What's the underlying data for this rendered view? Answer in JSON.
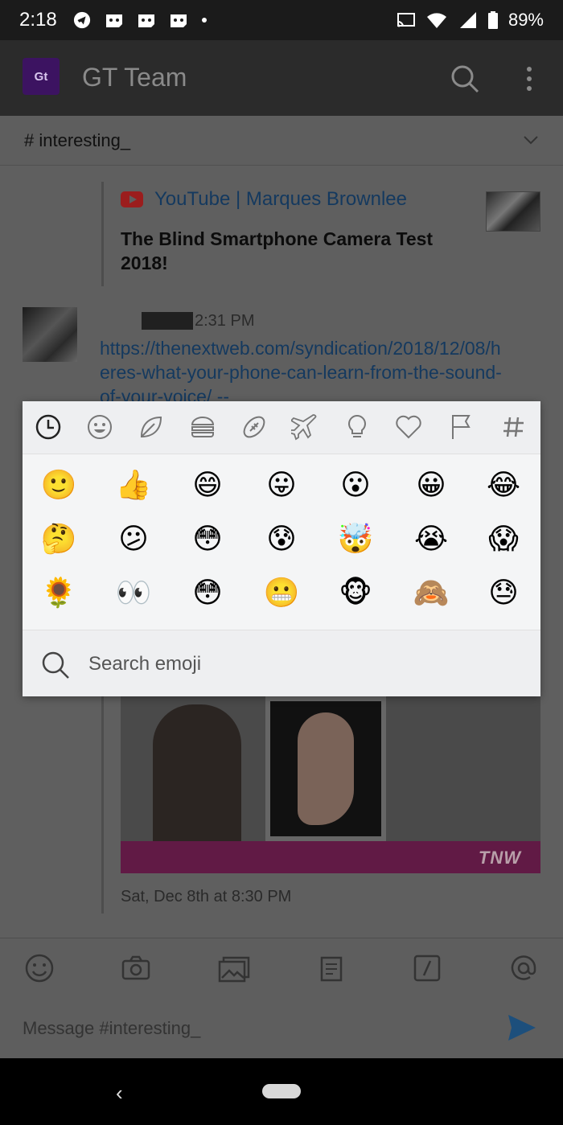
{
  "status_bar": {
    "time": "2:18",
    "battery": "89%",
    "left_icons": [
      "telegram-icon",
      "discord-icon",
      "discord-icon",
      "discord-icon",
      "dot-icon"
    ],
    "right_icons": [
      "cast-icon",
      "wifi-icon",
      "signal-icon",
      "battery-icon"
    ]
  },
  "header": {
    "logo_text": "Gt",
    "team_name": "GT Team",
    "icons": [
      "search-icon",
      "more-vertical-icon"
    ]
  },
  "channel": {
    "name": "# interesting_",
    "dropdown_icon": "chevron-down-icon"
  },
  "messages": {
    "youtube_attachment": {
      "source": "YouTube | Marques Brownlee",
      "title": "The Blind Smartphone Camera Test 2018!"
    },
    "link_message": {
      "time": "2:31 PM",
      "link": "https://thenextweb.com/syndication/2018/12/08/heres-what-your-phone-can-learn-from-the-sound-of-your-voice/ --"
    },
    "article_preview": {
      "watermark": "TNW",
      "date": "Sat, Dec 8th at 8:30 PM"
    }
  },
  "emoji_picker": {
    "tabs": [
      {
        "name": "recent",
        "icon": "clock-icon"
      },
      {
        "name": "smileys",
        "icon": "smiley-icon"
      },
      {
        "name": "nature",
        "icon": "leaf-icon"
      },
      {
        "name": "food",
        "icon": "burger-icon"
      },
      {
        "name": "activity",
        "icon": "football-icon"
      },
      {
        "name": "travel",
        "icon": "airplane-icon"
      },
      {
        "name": "objects",
        "icon": "lightbulb-icon"
      },
      {
        "name": "symbols",
        "icon": "heart-icon"
      },
      {
        "name": "flags",
        "icon": "flag-icon"
      },
      {
        "name": "custom",
        "icon": "hashtag-icon"
      }
    ],
    "emojis": [
      [
        "🙂",
        "👍",
        "😄",
        "😛",
        "😮",
        "😀",
        "😂"
      ],
      [
        "🤔",
        "😕",
        "😳",
        "😰",
        "🤯",
        "😭",
        "😱"
      ],
      [
        "🌻",
        "👀",
        "😳",
        "😬",
        "🐵",
        "🙈",
        "😓"
      ]
    ],
    "search_placeholder": "Search emoji"
  },
  "toolbar": {
    "icons": [
      "emoji-icon",
      "camera-icon",
      "gallery-icon",
      "file-icon",
      "slash-command-icon",
      "mention-icon"
    ]
  },
  "composer": {
    "placeholder": "Message #interesting_",
    "send_icon": "send-icon"
  },
  "nav_bar": {
    "back_symbol": "‹"
  }
}
